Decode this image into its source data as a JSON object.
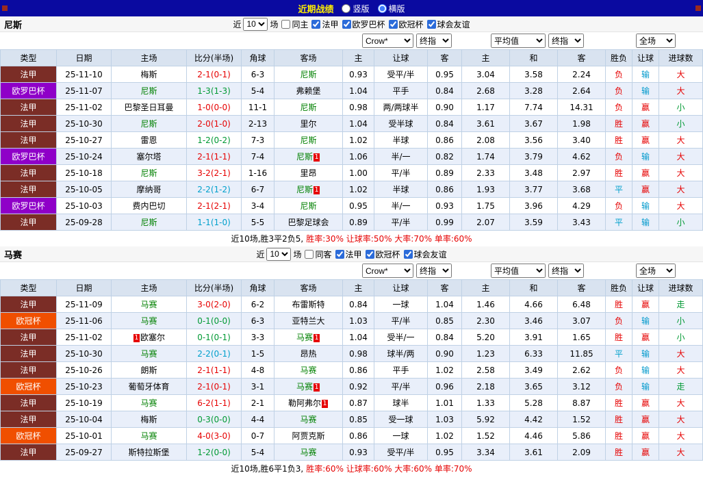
{
  "topbar": {
    "title": "近期战绩",
    "radio_vertical": "竖版",
    "radio_horizontal": "横版",
    "selected_layout": "横版"
  },
  "colors": {
    "topbar_bg": "#0a0aa0",
    "title_text": "#ffef00",
    "ligue1_badge": "#7b2d26",
    "europa_badge": "#8f00c8",
    "ucl_badge": "#f04f00",
    "focus_team": "#008000",
    "win_red": "#e60000",
    "draw_blue": "#00a0cc",
    "under_green": "#009933"
  },
  "sections": [
    {
      "team": "尼斯",
      "filter": {
        "near": "近",
        "count": "10",
        "games": "场",
        "same": "同主",
        "same_checked": false,
        "leagues": [
          "法甲",
          "欧罗巴杯",
          "欧冠杯",
          "球会友谊"
        ]
      },
      "selects": {
        "bookmaker": "Crow*",
        "final_a": "终指",
        "average": "平均值",
        "final_b": "终指",
        "scope": "全场"
      },
      "headers": [
        "类型",
        "日期",
        "主场",
        "比分(半场)",
        "角球",
        "客场",
        "主",
        "让球",
        "客",
        "主",
        "和",
        "客",
        "胜负",
        "让球",
        "进球数"
      ],
      "rows": [
        {
          "league": "法甲",
          "league_type": "ligue1",
          "date": "25-11-10",
          "home_name": "梅斯",
          "home_focus": false,
          "home_card_before": false,
          "score": "2-1(0-1)",
          "score_type": "home-win",
          "corners": "6-3",
          "away_name": "尼斯",
          "away_focus": true,
          "away_card": false,
          "odds_home": "0.93",
          "handicap": "受平/半",
          "odds_away": "0.95",
          "avg_home": "3.04",
          "avg_draw": "3.58",
          "avg_away": "2.24",
          "result": "负",
          "result_type": "loss",
          "handicap_result": "输",
          "handicap_result_type": "lose",
          "goals_result": "大",
          "goals_result_type": "over"
        },
        {
          "league": "欧罗巴杯",
          "league_type": "europa",
          "date": "25-11-07",
          "home_name": "尼斯",
          "home_focus": true,
          "home_card_before": false,
          "score": "1-3(1-3)",
          "score_type": "away-win",
          "corners": "5-4",
          "away_name": "弗赖堡",
          "away_focus": false,
          "away_card": false,
          "odds_home": "1.04",
          "handicap": "平手",
          "odds_away": "0.84",
          "avg_home": "2.68",
          "avg_draw": "3.28",
          "avg_away": "2.64",
          "result": "负",
          "result_type": "loss",
          "handicap_result": "输",
          "handicap_result_type": "lose",
          "goals_result": "大",
          "goals_result_type": "over"
        },
        {
          "league": "法甲",
          "league_type": "ligue1",
          "date": "25-11-02",
          "home_name": "巴黎圣日耳曼",
          "home_focus": false,
          "home_card_before": false,
          "score": "1-0(0-0)",
          "score_type": "home-win",
          "corners": "11-1",
          "away_name": "尼斯",
          "away_focus": true,
          "away_card": false,
          "odds_home": "0.98",
          "handicap": "两/两球半",
          "odds_away": "0.90",
          "avg_home": "1.17",
          "avg_draw": "7.74",
          "avg_away": "14.31",
          "result": "负",
          "result_type": "loss",
          "handicap_result": "赢",
          "handicap_result_type": "cover",
          "goals_result": "小",
          "goals_result_type": "under"
        },
        {
          "league": "法甲",
          "league_type": "ligue1",
          "date": "25-10-30",
          "home_name": "尼斯",
          "home_focus": true,
          "home_card_before": false,
          "score": "2-0(1-0)",
          "score_type": "home-win",
          "corners": "2-13",
          "away_name": "里尔",
          "away_focus": false,
          "away_card": false,
          "odds_home": "1.04",
          "handicap": "受半球",
          "odds_away": "0.84",
          "avg_home": "3.61",
          "avg_draw": "3.67",
          "avg_away": "1.98",
          "result": "胜",
          "result_type": "win",
          "handicap_result": "赢",
          "handicap_result_type": "cover",
          "goals_result": "小",
          "goals_result_type": "under"
        },
        {
          "league": "法甲",
          "league_type": "ligue1",
          "date": "25-10-27",
          "home_name": "雷恩",
          "home_focus": false,
          "home_card_before": false,
          "score": "1-2(0-2)",
          "score_type": "away-win",
          "corners": "7-3",
          "away_name": "尼斯",
          "away_focus": true,
          "away_card": false,
          "odds_home": "1.02",
          "handicap": "半球",
          "odds_away": "0.86",
          "avg_home": "2.08",
          "avg_draw": "3.56",
          "avg_away": "3.40",
          "result": "胜",
          "result_type": "win",
          "handicap_result": "赢",
          "handicap_result_type": "cover",
          "goals_result": "大",
          "goals_result_type": "over"
        },
        {
          "league": "欧罗巴杯",
          "league_type": "europa",
          "date": "25-10-24",
          "home_name": "塞尔塔",
          "home_focus": false,
          "home_card_before": false,
          "score": "2-1(1-1)",
          "score_type": "home-win",
          "corners": "7-4",
          "away_name": "尼斯",
          "away_focus": true,
          "away_card": true,
          "odds_home": "1.06",
          "handicap": "半/一",
          "odds_away": "0.82",
          "avg_home": "1.74",
          "avg_draw": "3.79",
          "avg_away": "4.62",
          "result": "负",
          "result_type": "loss",
          "handicap_result": "输",
          "handicap_result_type": "lose",
          "goals_result": "大",
          "goals_result_type": "over"
        },
        {
          "league": "法甲",
          "league_type": "ligue1",
          "date": "25-10-18",
          "home_name": "尼斯",
          "home_focus": true,
          "home_card_before": false,
          "score": "3-2(2-1)",
          "score_type": "home-win",
          "corners": "1-16",
          "away_name": "里昂",
          "away_focus": false,
          "away_card": false,
          "odds_home": "1.00",
          "handicap": "平/半",
          "odds_away": "0.89",
          "avg_home": "2.33",
          "avg_draw": "3.48",
          "avg_away": "2.97",
          "result": "胜",
          "result_type": "win",
          "handicap_result": "赢",
          "handicap_result_type": "cover",
          "goals_result": "大",
          "goals_result_type": "over"
        },
        {
          "league": "法甲",
          "league_type": "ligue1",
          "date": "25-10-05",
          "home_name": "摩纳哥",
          "home_focus": false,
          "home_card_before": false,
          "score": "2-2(1-2)",
          "score_type": "draw",
          "corners": "6-7",
          "away_name": "尼斯",
          "away_focus": true,
          "away_card": true,
          "odds_home": "1.02",
          "handicap": "半球",
          "odds_away": "0.86",
          "avg_home": "1.93",
          "avg_draw": "3.77",
          "avg_away": "3.68",
          "result": "平",
          "result_type": "draw",
          "handicap_result": "赢",
          "handicap_result_type": "cover",
          "goals_result": "大",
          "goals_result_type": "over"
        },
        {
          "league": "欧罗巴杯",
          "league_type": "europa",
          "date": "25-10-03",
          "home_name": "费内巴切",
          "home_focus": false,
          "home_card_before": false,
          "score": "2-1(2-1)",
          "score_type": "home-win",
          "corners": "3-4",
          "away_name": "尼斯",
          "away_focus": true,
          "away_card": false,
          "odds_home": "0.95",
          "handicap": "半/一",
          "odds_away": "0.93",
          "avg_home": "1.75",
          "avg_draw": "3.96",
          "avg_away": "4.29",
          "result": "负",
          "result_type": "loss",
          "handicap_result": "输",
          "handicap_result_type": "lose",
          "goals_result": "大",
          "goals_result_type": "over"
        },
        {
          "league": "法甲",
          "league_type": "ligue1",
          "date": "25-09-28",
          "home_name": "尼斯",
          "home_focus": true,
          "home_card_before": false,
          "score": "1-1(1-0)",
          "score_type": "draw",
          "corners": "5-5",
          "away_name": "巴黎足球会",
          "away_focus": false,
          "away_card": false,
          "odds_home": "0.89",
          "handicap": "平/半",
          "odds_away": "0.99",
          "avg_home": "2.07",
          "avg_draw": "3.59",
          "avg_away": "3.43",
          "result": "平",
          "result_type": "draw",
          "handicap_result": "输",
          "handicap_result_type": "lose",
          "goals_result": "小",
          "goals_result_type": "under"
        }
      ],
      "summary": {
        "prefix": "近10场,胜3平2负5,",
        "stats": "胜率:30% 让球率:50% 大率:70% 单率:60%"
      }
    },
    {
      "team": "马赛",
      "filter": {
        "near": "近",
        "count": "10",
        "games": "场",
        "same": "同客",
        "same_checked": false,
        "leagues": [
          "法甲",
          "欧冠杯",
          "球会友谊"
        ]
      },
      "selects": {
        "bookmaker": "Crow*",
        "final_a": "终指",
        "average": "平均值",
        "final_b": "终指",
        "scope": "全场"
      },
      "headers": [
        "类型",
        "日期",
        "主场",
        "比分(半场)",
        "角球",
        "客场",
        "主",
        "让球",
        "客",
        "主",
        "和",
        "客",
        "胜负",
        "让球",
        "进球数"
      ],
      "rows": [
        {
          "league": "法甲",
          "league_type": "ligue1",
          "date": "25-11-09",
          "home_name": "马赛",
          "home_focus": true,
          "home_card_before": false,
          "score": "3-0(2-0)",
          "score_type": "home-win",
          "corners": "6-2",
          "away_name": "布雷斯特",
          "away_focus": false,
          "away_card": false,
          "odds_home": "0.84",
          "handicap": "一球",
          "odds_away": "1.04",
          "avg_home": "1.46",
          "avg_draw": "4.66",
          "avg_away": "6.48",
          "result": "胜",
          "result_type": "win",
          "handicap_result": "赢",
          "handicap_result_type": "cover",
          "goals_result": "走",
          "goals_result_type": "push"
        },
        {
          "league": "欧冠杯",
          "league_type": "ucl",
          "date": "25-11-06",
          "home_name": "马赛",
          "home_focus": true,
          "home_card_before": false,
          "score": "0-1(0-0)",
          "score_type": "away-win",
          "corners": "6-3",
          "away_name": "亚特兰大",
          "away_focus": false,
          "away_card": false,
          "odds_home": "1.03",
          "handicap": "平/半",
          "odds_away": "0.85",
          "avg_home": "2.30",
          "avg_draw": "3.46",
          "avg_away": "3.07",
          "result": "负",
          "result_type": "loss",
          "handicap_result": "输",
          "handicap_result_type": "lose",
          "goals_result": "小",
          "goals_result_type": "under"
        },
        {
          "league": "法甲",
          "league_type": "ligue1",
          "date": "25-11-02",
          "home_name": "欧塞尔",
          "home_focus": false,
          "home_card_before": true,
          "score": "0-1(0-1)",
          "score_type": "away-win",
          "corners": "3-3",
          "away_name": "马赛",
          "away_focus": true,
          "away_card": true,
          "odds_home": "1.04",
          "handicap": "受半/一",
          "odds_away": "0.84",
          "avg_home": "5.20",
          "avg_draw": "3.91",
          "avg_away": "1.65",
          "result": "胜",
          "result_type": "win",
          "handicap_result": "赢",
          "handicap_result_type": "cover",
          "goals_result": "小",
          "goals_result_type": "under"
        },
        {
          "league": "法甲",
          "league_type": "ligue1",
          "date": "25-10-30",
          "home_name": "马赛",
          "home_focus": true,
          "home_card_before": false,
          "score": "2-2(0-1)",
          "score_type": "draw",
          "corners": "1-5",
          "away_name": "昂热",
          "away_focus": false,
          "away_card": false,
          "odds_home": "0.98",
          "handicap": "球半/两",
          "odds_away": "0.90",
          "avg_home": "1.23",
          "avg_draw": "6.33",
          "avg_away": "11.85",
          "result": "平",
          "result_type": "draw",
          "handicap_result": "输",
          "handicap_result_type": "lose",
          "goals_result": "大",
          "goals_result_type": "over"
        },
        {
          "league": "法甲",
          "league_type": "ligue1",
          "date": "25-10-26",
          "home_name": "朗斯",
          "home_focus": false,
          "home_card_before": false,
          "score": "2-1(1-1)",
          "score_type": "home-win",
          "corners": "4-8",
          "away_name": "马赛",
          "away_focus": true,
          "away_card": false,
          "odds_home": "0.86",
          "handicap": "平手",
          "odds_away": "1.02",
          "avg_home": "2.58",
          "avg_draw": "3.49",
          "avg_away": "2.62",
          "result": "负",
          "result_type": "loss",
          "handicap_result": "输",
          "handicap_result_type": "lose",
          "goals_result": "大",
          "goals_result_type": "over"
        },
        {
          "league": "欧冠杯",
          "league_type": "ucl",
          "date": "25-10-23",
          "home_name": "葡萄牙体育",
          "home_focus": false,
          "home_card_before": false,
          "score": "2-1(0-1)",
          "score_type": "home-win",
          "corners": "3-1",
          "away_name": "马赛",
          "away_focus": true,
          "away_card": true,
          "odds_home": "0.92",
          "handicap": "平/半",
          "odds_away": "0.96",
          "avg_home": "2.18",
          "avg_draw": "3.65",
          "avg_away": "3.12",
          "result": "负",
          "result_type": "loss",
          "handicap_result": "输",
          "handicap_result_type": "lose",
          "goals_result": "走",
          "goals_result_type": "push"
        },
        {
          "league": "法甲",
          "league_type": "ligue1",
          "date": "25-10-19",
          "home_name": "马赛",
          "home_focus": true,
          "home_card_before": false,
          "score": "6-2(1-1)",
          "score_type": "home-win",
          "corners": "2-1",
          "away_name": "勒阿弗尔",
          "away_focus": false,
          "away_card": true,
          "odds_home": "0.87",
          "handicap": "球半",
          "odds_away": "1.01",
          "avg_home": "1.33",
          "avg_draw": "5.28",
          "avg_away": "8.87",
          "result": "胜",
          "result_type": "win",
          "handicap_result": "赢",
          "handicap_result_type": "cover",
          "goals_result": "大",
          "goals_result_type": "over"
        },
        {
          "league": "法甲",
          "league_type": "ligue1",
          "date": "25-10-04",
          "home_name": "梅斯",
          "home_focus": false,
          "home_card_before": false,
          "score": "0-3(0-0)",
          "score_type": "away-win",
          "corners": "4-4",
          "away_name": "马赛",
          "away_focus": true,
          "away_card": false,
          "odds_home": "0.85",
          "handicap": "受一球",
          "odds_away": "1.03",
          "avg_home": "5.92",
          "avg_draw": "4.42",
          "avg_away": "1.52",
          "result": "胜",
          "result_type": "win",
          "handicap_result": "赢",
          "handicap_result_type": "cover",
          "goals_result": "大",
          "goals_result_type": "over"
        },
        {
          "league": "欧冠杯",
          "league_type": "ucl",
          "date": "25-10-01",
          "home_name": "马赛",
          "home_focus": true,
          "home_card_before": false,
          "score": "4-0(3-0)",
          "score_type": "home-win",
          "corners": "0-7",
          "away_name": "阿贾克斯",
          "away_focus": false,
          "away_card": false,
          "odds_home": "0.86",
          "handicap": "一球",
          "odds_away": "1.02",
          "avg_home": "1.52",
          "avg_draw": "4.46",
          "avg_away": "5.86",
          "result": "胜",
          "result_type": "win",
          "handicap_result": "赢",
          "handicap_result_type": "cover",
          "goals_result": "大",
          "goals_result_type": "over"
        },
        {
          "league": "法甲",
          "league_type": "ligue1",
          "date": "25-09-27",
          "home_name": "斯特拉斯堡",
          "home_focus": false,
          "home_card_before": false,
          "score": "1-2(0-0)",
          "score_type": "away-win",
          "corners": "5-4",
          "away_name": "马赛",
          "away_focus": true,
          "away_card": false,
          "odds_home": "0.93",
          "handicap": "受平/半",
          "odds_away": "0.95",
          "avg_home": "3.34",
          "avg_draw": "3.61",
          "avg_away": "2.09",
          "result": "胜",
          "result_type": "win",
          "handicap_result": "赢",
          "handicap_result_type": "cover",
          "goals_result": "大",
          "goals_result_type": "over"
        }
      ],
      "summary": {
        "prefix": "近10场,胜6平1负3,",
        "stats": "胜率:60% 让球率:60% 大率:60% 单率:70%"
      }
    }
  ]
}
